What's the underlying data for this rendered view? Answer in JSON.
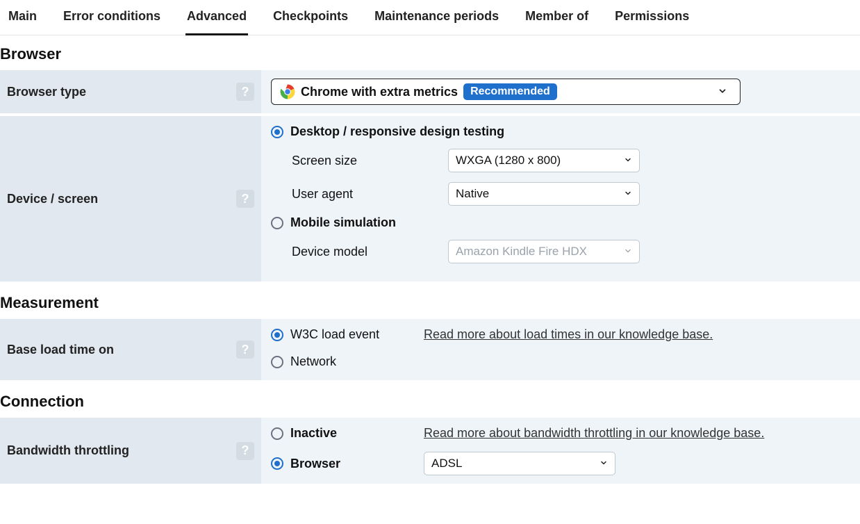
{
  "tabs": {
    "main": "Main",
    "error_conditions": "Error conditions",
    "advanced": "Advanced",
    "checkpoints": "Checkpoints",
    "maintenance": "Maintenance periods",
    "member_of": "Member of",
    "permissions": "Permissions"
  },
  "browser": {
    "heading": "Browser",
    "type_label": "Browser type",
    "dropdown_text": "Chrome with extra metrics",
    "badge": "Recommended",
    "device_label": "Device / screen",
    "desktop_option": "Desktop / responsive design testing",
    "screen_size_label": "Screen size",
    "screen_size_value": "WXGA (1280 x 800)",
    "user_agent_label": "User agent",
    "user_agent_value": "Native",
    "mobile_option": "Mobile simulation",
    "device_model_label": "Device model",
    "device_model_value": "Amazon Kindle Fire HDX"
  },
  "measurement": {
    "heading": "Measurement",
    "base_load_label": "Base load time on",
    "w3c_option": "W3C load event",
    "load_link": "Read more about load times in our knowledge base.",
    "network_option": "Network"
  },
  "connection": {
    "heading": "Connection",
    "bandwidth_label": "Bandwidth throttling",
    "inactive_option": "Inactive",
    "bandwidth_link": "Read more about bandwidth throttling in our knowledge base.",
    "browser_option": "Browser",
    "adsl_value": "ADSL"
  },
  "icons": {
    "help": "?"
  }
}
